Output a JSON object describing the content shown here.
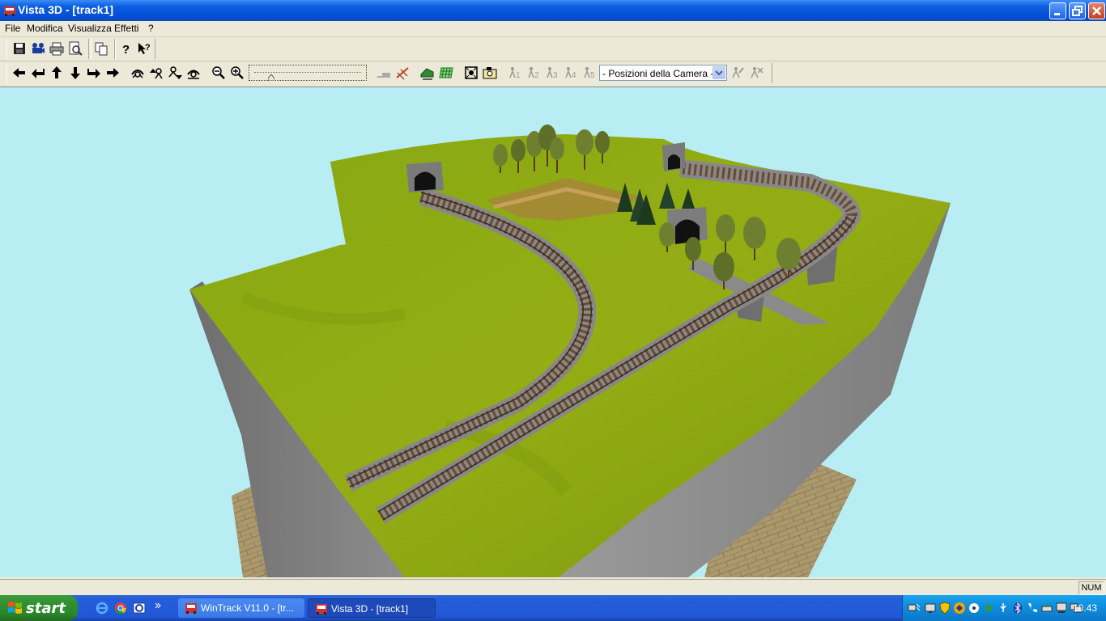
{
  "window": {
    "title": "Vista 3D - [track1]"
  },
  "menu": [
    "File",
    "Modifica",
    "Visualizza",
    "Effetti",
    "?"
  ],
  "camera_select": {
    "value": "- Posizioni della Camera -"
  },
  "camera_positions": [
    "1",
    "2",
    "3",
    "4",
    "5"
  ],
  "statusbar": {
    "num": "NUM"
  },
  "taskbar": {
    "start": "start",
    "tasks": [
      {
        "label": "WinTrack  V11.0 - [tr..."
      },
      {
        "label": "Vista 3D - [track1]"
      }
    ],
    "clock": "10.43"
  },
  "colors": {
    "sky": "#b8eef3",
    "grass": "#8faa10",
    "cliff": "#7a7a7a",
    "floor": "#a8956a",
    "titlebar": "#0a5fe0"
  }
}
